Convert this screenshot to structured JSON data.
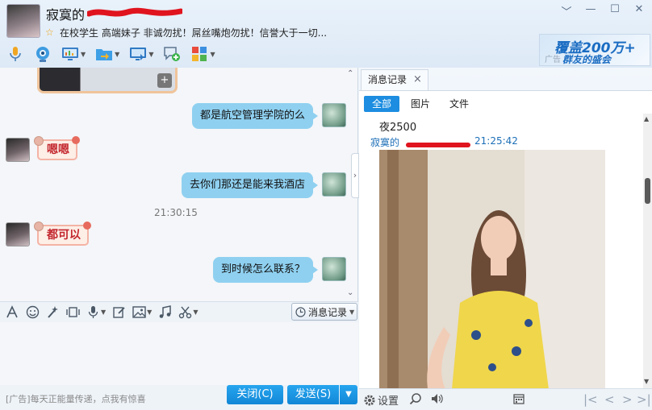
{
  "header": {
    "contact_name": "寂寞的",
    "signature": "在校学生 高端妹子 非诚勿扰！屌丝嘴炮勿扰！信誉大于一切...",
    "window_controls": [
      "﹀",
      "—",
      "☐",
      "✕"
    ]
  },
  "ad_banner": {
    "tag": "广告",
    "line1": "覆盖200万+",
    "line2": "群友的盛会"
  },
  "chat": {
    "messages": [
      {
        "from": "self",
        "text": "都是航空管理学院的么"
      },
      {
        "from": "peer",
        "text": "嗯嗯"
      },
      {
        "from": "self",
        "text": "去你们那还是能来我酒店"
      },
      {
        "from": "peer",
        "text": "都可以"
      },
      {
        "from": "self",
        "text": "到时候怎么联系？"
      }
    ],
    "timestamp": "21:30:15"
  },
  "input_toolbar": {
    "history_button": "消息记录"
  },
  "footer": {
    "ad_text": "[广告]每天正能量传递，点我有惊喜",
    "close_button": "关闭(C)",
    "send_button": "发送(S)"
  },
  "history": {
    "tab_label": "消息记录",
    "filters": [
      "全部",
      "图片",
      "文件"
    ],
    "active_filter": "全部",
    "line1": "夜2500",
    "sender": "寂寞的",
    "time": "21:25:42",
    "settings_label": "设置"
  },
  "colors": {
    "accent": "#1c8de0",
    "bubble_out": "#8fd0f0",
    "sticker_text": "#c3262d"
  }
}
